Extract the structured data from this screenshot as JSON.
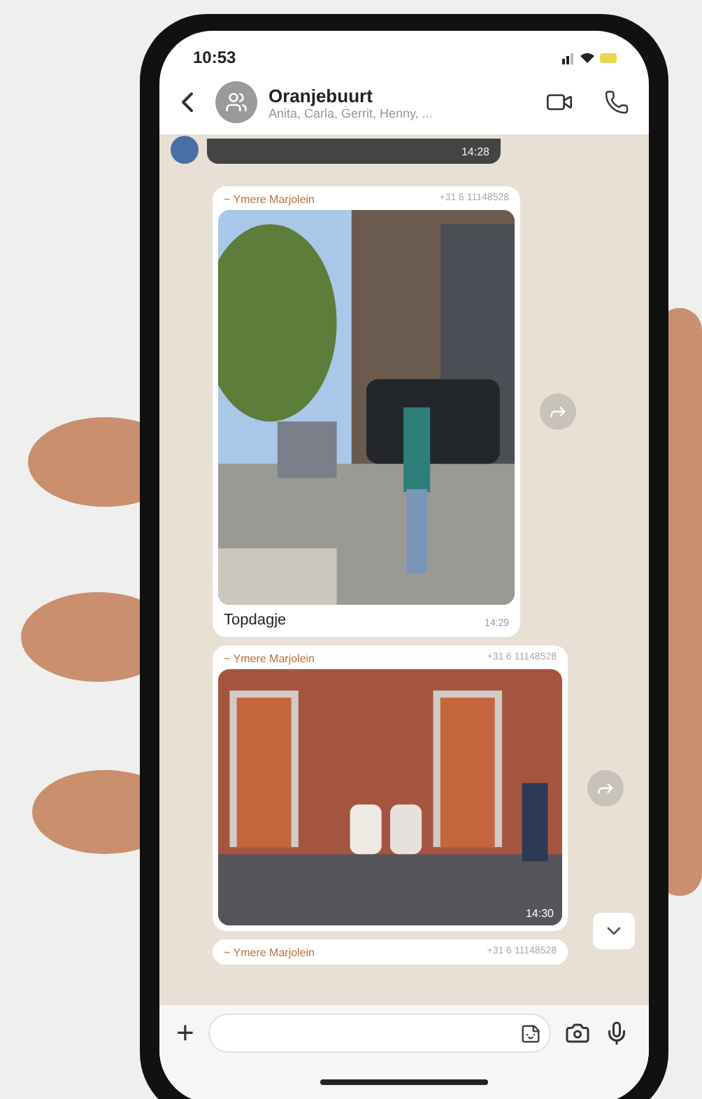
{
  "status_bar": {
    "time": "10:53"
  },
  "header": {
    "title": "Oranjebuurt",
    "subtitle": "Anita, Carla, Gerrit, Henny, ..."
  },
  "messages": [
    {
      "kind": "tail",
      "time": "14:28"
    },
    {
      "sender": "~ Ymere Marjolein",
      "phone": "+31 6 11148528",
      "caption": "Topdagje",
      "time": "14:29"
    },
    {
      "sender": "~ Ymere Marjolein",
      "phone": "+31 6 11148528",
      "time": "14:30"
    },
    {
      "kind": "header",
      "sender": "~ Ymere Marjolein",
      "phone": "+31 6 11148528"
    }
  ],
  "composer": {
    "plus": "+"
  }
}
